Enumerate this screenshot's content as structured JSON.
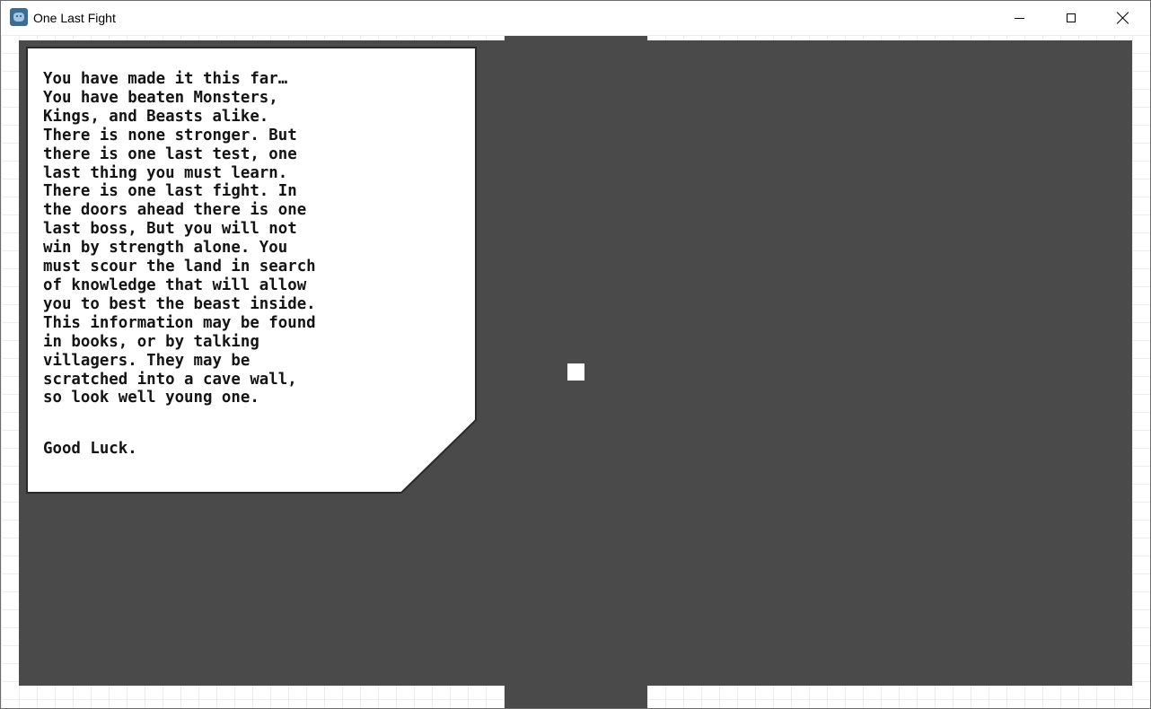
{
  "window": {
    "title": "One Last Fight",
    "app_icon": "godot-engine-icon",
    "controls": [
      "minimize-icon",
      "maximize-icon",
      "close-icon"
    ]
  },
  "game": {
    "background_color": "#4a4a4a",
    "player_color": "#ffffff",
    "dialog": {
      "text": "You have made it this far…\nYou have beaten Monsters,\nKings, and Beasts alike.\nThere is none stronger. But\nthere is one last test, one\nlast thing you must learn.\nThere is one last fight. In\nthe doors ahead there is one\nlast boss, But you will not\nwin by strength alone. You\nmust scour the land in search\nof knowledge that will allow\nyou to best the beast inside.\nThis information may be found\nin books, or by talking\nvillagers. They may be\nscratched into a cave wall,\nso look well young one.",
      "signoff": "Good Luck."
    }
  }
}
